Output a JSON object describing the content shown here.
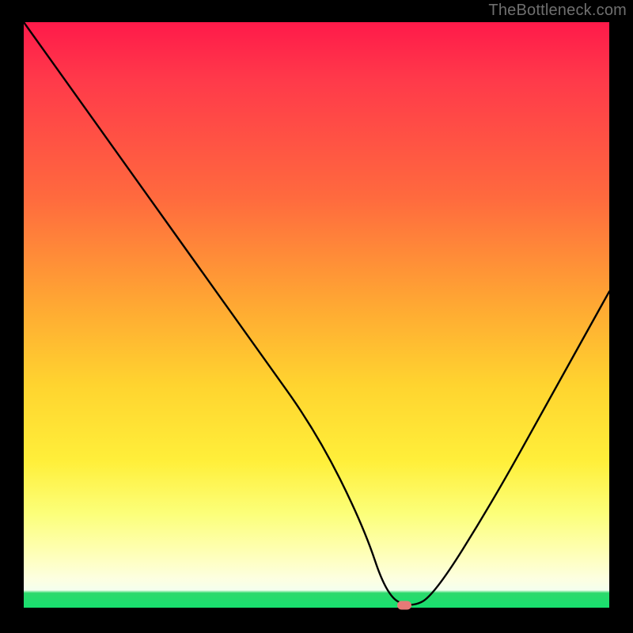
{
  "watermark": "TheBottleneck.com",
  "chart_data": {
    "type": "line",
    "title": "",
    "xlabel": "",
    "ylabel": "",
    "xlim": [
      0,
      100
    ],
    "ylim": [
      0,
      100
    ],
    "grid": false,
    "series": [
      {
        "name": "bottleneck-curve",
        "x": [
          0,
          10,
          20,
          30,
          40,
          50,
          58,
          62,
          66,
          70,
          80,
          90,
          100
        ],
        "y": [
          100,
          86,
          72,
          58,
          44,
          30,
          14,
          2,
          0,
          2,
          18,
          36,
          54
        ]
      }
    ],
    "optimal_marker": {
      "x": 65,
      "y": 0
    },
    "gradient_stops": [
      {
        "pos": 0,
        "color": "#ff1a4a"
      },
      {
        "pos": 0.48,
        "color": "#ffa733"
      },
      {
        "pos": 0.75,
        "color": "#ffef3a"
      },
      {
        "pos": 0.95,
        "color": "#fdffe0"
      },
      {
        "pos": 1.0,
        "color": "#18e06f"
      }
    ]
  }
}
